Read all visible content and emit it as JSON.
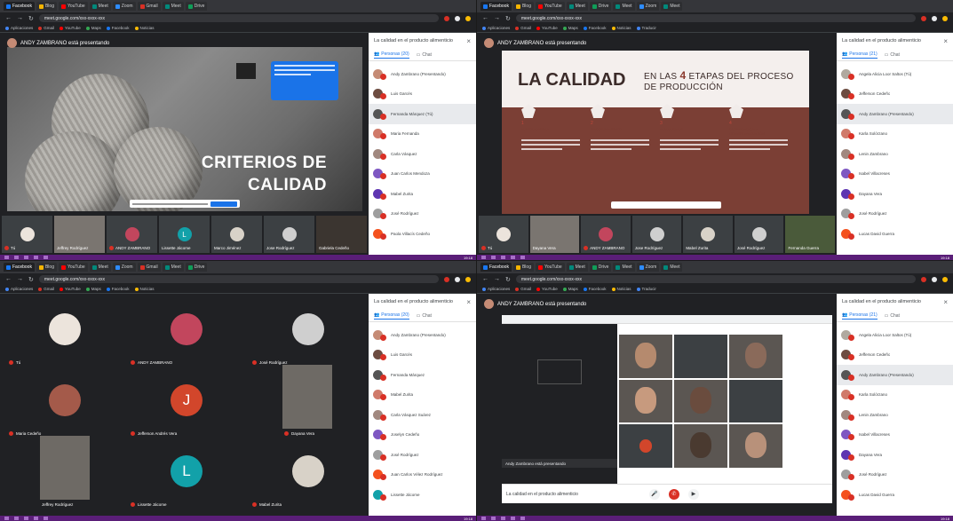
{
  "screens": [
    {
      "presenter": "ANDY ZAMBRANO está presentando",
      "slide_title_line1": "CRITERIOS DE",
      "slide_title_line2": "CALIDAD",
      "panel_title": "La calidad en el producto alimenticio",
      "tab_people": "Personas (20)",
      "tab_chat": "Chat",
      "participants": [
        "Andy Zambrano (Presentando)",
        "Luis Garcés",
        "Fernanda Márquez (Tú)",
        "Maria Fernanda",
        "Carla Vásquez",
        "Juan Carlos Mendoza",
        "Mabel Zurita",
        "José Rodríguez",
        "Paola Villacís Cedeño"
      ],
      "strip": [
        "Tú",
        "Jeffrey Rodríguez",
        "ANDY ZAMBRANO",
        "Lissette Jácome",
        "Marco Jiménez",
        "Jose Rodríguez",
        "Gabriela Cedeño"
      ]
    },
    {
      "presenter": "ANDY ZAMBRANO está presentando",
      "slide_title": "LA CALIDAD",
      "slide_sub_pre": "EN LAS",
      "slide_sub_num": "4",
      "slide_sub_post": "ETAPAS DEL PROCESO DE PRODUCCIÓN",
      "steps": [
        {
          "num": "1",
          "label": "MATERIA PRIMA"
        },
        {
          "num": "2",
          "label": "PROCESAMIENTO"
        },
        {
          "num": "3",
          "label": "ALMACENAJE"
        },
        {
          "num": "4",
          "label": "DISTRIBUCIÓN Y COMERCIALIZACIÓN"
        }
      ],
      "panel_title": "La calidad en el producto alimenticio",
      "tab_people": "Personas (21)",
      "tab_chat": "Chat",
      "participants": [
        "Angela Alicia Loor Saltos (Tú)",
        "Jefferson Cedeño",
        "Andy Zambrano (Presentando)",
        "Karla Solórzano",
        "Lenin Zambrano",
        "Isabel Villacreses",
        "Dayana Vera",
        "José Rodríguez",
        "Lucas David Guerra"
      ],
      "strip": [
        "Tú",
        "Dayana Vera",
        "ANDY ZAMBRANO",
        "Jose Rodríguez",
        "Mabel Zurita",
        "José Rodríguez",
        "Fernanda Guerra"
      ]
    },
    {
      "panel_title": "La calidad en el producto alimenticio",
      "tab_people": "Personas (20)",
      "tab_chat": "Chat",
      "participants": [
        "Andy Zambrano (Presentando)",
        "Luis Garcés",
        "Fernanda Márquez",
        "Mabel Zurita",
        "Carla Vásquez Suárez",
        "Joselyn Cedeño",
        "José Rodríguez",
        "Juan Carlos Vélez Rodríguez",
        "Lissette Jácome"
      ],
      "grid": [
        {
          "name": "Tú",
          "initial": "",
          "color": "#ece4dc"
        },
        {
          "name": "ANDY ZAMBRANO",
          "initial": "",
          "color": "#c2465d"
        },
        {
          "name": "José Rodríguez",
          "initial": "",
          "color": "#cfcfcf"
        },
        {
          "name": "Maria Cedeño",
          "initial": "",
          "color": "#a45a4a"
        },
        {
          "name": "Jefferson Andrés Vera",
          "initial": "J",
          "color": "#d2462b"
        },
        {
          "name": "Dayana Vera",
          "initial": "",
          "color": "#8e8a85"
        },
        {
          "name": "Jeffrey Rodríguez",
          "initial": "",
          "color": "#8f8a84"
        },
        {
          "name": "Lissette Jácome",
          "initial": "L",
          "color": "#12a1a9"
        },
        {
          "name": "Mabel Zurita",
          "initial": "",
          "color": "#d8d2c8"
        }
      ]
    },
    {
      "presenter": "ANDY ZAMBRANO está presentando",
      "caption": "Andy Zambrano está presentando",
      "meeting_name": "La calidad en el producto alimenticio",
      "panel_title": "La calidad en el producto alimenticio",
      "tab_people": "Personas (21)",
      "tab_chat": "Chat",
      "participants": [
        "Angela Alicia Loor Saltos (Tú)",
        "Jefferson Cedeño",
        "Andy Zambrano (Presentando)",
        "Karla Solórzano",
        "Lenin Zambrano",
        "Isabel Villacreses",
        "Dayana Vera",
        "José Rodríguez",
        "Lucas David Guerra"
      ]
    }
  ],
  "tabs_left": [
    "Facebook",
    "Blog",
    "YouTube",
    "Meet",
    "Zoom",
    "Gmail",
    "Meet",
    "Drive",
    "Meet"
  ],
  "tabs_right": [
    "Facebook",
    "Blog",
    "YouTube",
    "Meet",
    "Drive",
    "Meet",
    "Zoom",
    "Meet",
    "Drive"
  ],
  "url": "meet.google.com/xxx-xxxx-xxx",
  "bookmarks": [
    "Aplicaciones",
    "Gmail",
    "YouTube",
    "Maps",
    "Facebook",
    "Noticias",
    "Traducir",
    "Docs"
  ],
  "clock": "19:18",
  "icon_names": [
    "video-icon",
    "microphone-icon",
    "close-icon",
    "people-icon",
    "chat-icon"
  ],
  "colors": {
    "meet_bg": "#202124",
    "accent": "#1a73e8",
    "mic_off": "#d93025",
    "slide_brown": "#7b3f35",
    "taskbar": "#5a1e78"
  }
}
